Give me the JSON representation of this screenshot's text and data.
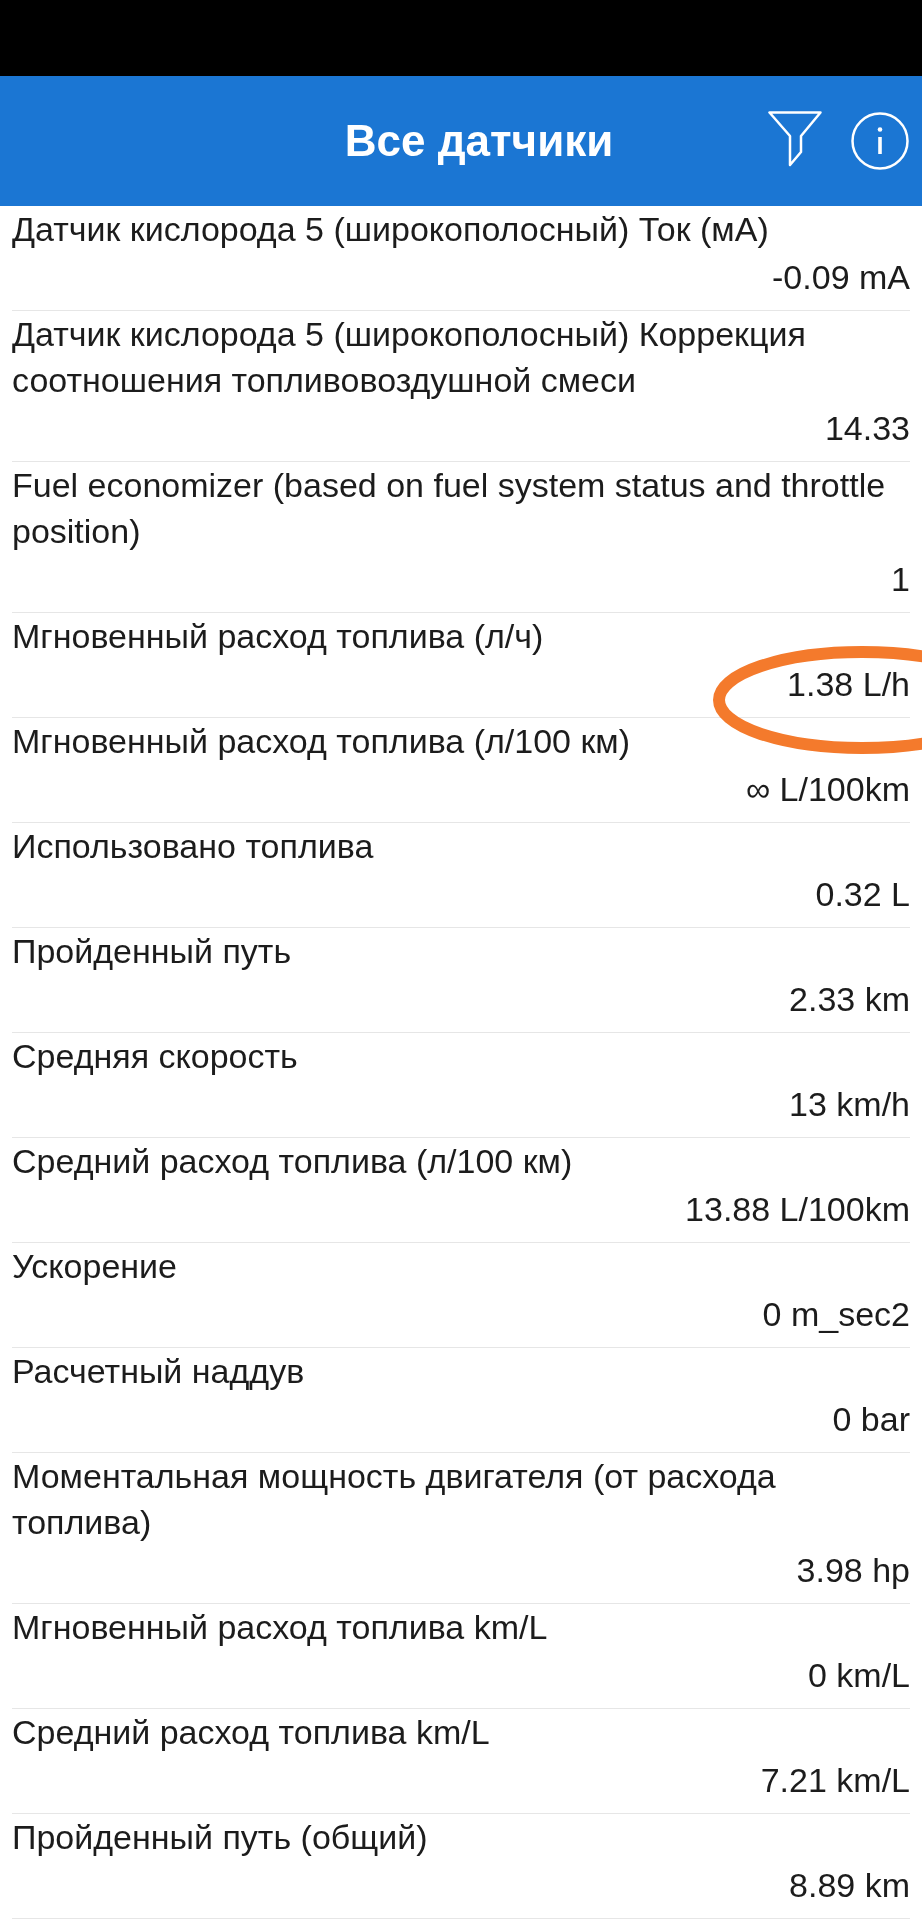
{
  "header": {
    "title": "Все датчики"
  },
  "rows": [
    {
      "label": "Датчик кислорода 5 (широкополосный) Ток (мА)",
      "value": "-0.09 mA",
      "circled": false
    },
    {
      "label": "Датчик кислорода 5 (широкополосный) Коррекция соотношения топливовоздушной смеси",
      "value": "14.33",
      "circled": false
    },
    {
      "label": "Fuel economizer (based on fuel system status and throttle position)",
      "value": "1",
      "circled": false
    },
    {
      "label": "Мгновенный расход топлива (л/ч)",
      "value": "1.38 L/h",
      "circled": true
    },
    {
      "label": "Мгновенный расход топлива (л/100 км)",
      "value": "∞ L/100km",
      "circled": false
    },
    {
      "label": "Использовано топлива",
      "value": "0.32 L",
      "circled": false
    },
    {
      "label": "Пройденный путь",
      "value": "2.33 km",
      "circled": false
    },
    {
      "label": "Средняя скорость",
      "value": "13 km/h",
      "circled": false
    },
    {
      "label": "Средний расход топлива (л/100 км)",
      "value": "13.88 L/100km",
      "circled": false
    },
    {
      "label": "Ускорение",
      "value": "0 m_sec2",
      "circled": false
    },
    {
      "label": "Расчетный наддув",
      "value": "0 bar",
      "circled": false
    },
    {
      "label": "Моментальная мощность двигателя (от расхода топлива)",
      "value": "3.98 hp",
      "circled": false
    },
    {
      "label": "Мгновенный расход топлива km/L",
      "value": "0 km/L",
      "circled": false
    },
    {
      "label": "Средний расход топлива km/L",
      "value": "7.21 km/L",
      "circled": false
    },
    {
      "label": "Пройденный путь (общий)",
      "value": "8.89 km",
      "circled": false
    }
  ]
}
